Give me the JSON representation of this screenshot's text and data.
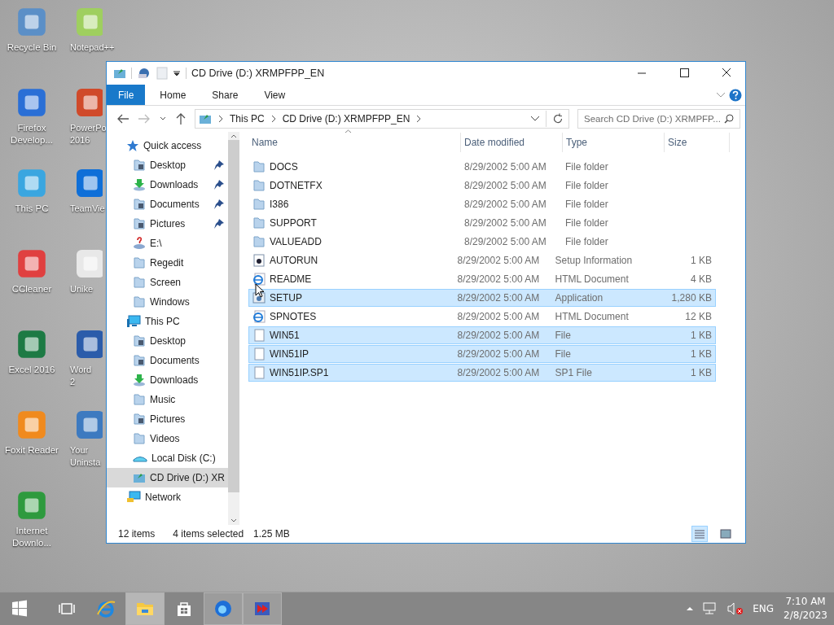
{
  "desktop_icons": [
    {
      "label": "Recycle Bin"
    },
    {
      "label": "Notepad++"
    },
    {
      "label": "Firefox Develop..."
    },
    {
      "label": "PowerPo 2016"
    },
    {
      "label": "This PC"
    },
    {
      "label": "TeamVie"
    },
    {
      "label": "CCleaner"
    },
    {
      "label": "Unike"
    },
    {
      "label": "Excel 2016"
    },
    {
      "label": "Word 2"
    },
    {
      "label": "Foxit Reader"
    },
    {
      "label": "Your Uninsta"
    },
    {
      "label": "Internet Downlo..."
    }
  ],
  "window": {
    "title": "CD Drive (D:) XRMPFPP_EN",
    "ribbon_tabs": [
      {
        "label": "File",
        "selected": true
      },
      {
        "label": "Home",
        "selected": false
      },
      {
        "label": "Share",
        "selected": false
      },
      {
        "label": "View",
        "selected": false
      }
    ],
    "breadcrumb": [
      "This PC",
      "CD Drive (D:) XRMPFPP_EN"
    ],
    "search": {
      "placeholder": "Search CD Drive (D:) XRMPFP..."
    },
    "sidebar": [
      {
        "label": "Quick access",
        "kind": "star",
        "selected": false,
        "children": [
          {
            "label": "Desktop",
            "kind": "desktop",
            "pinned": true,
            "selected": false
          },
          {
            "label": "Downloads",
            "kind": "download",
            "pinned": true,
            "selected": false
          },
          {
            "label": "Documents",
            "kind": "docs",
            "pinned": true,
            "selected": false
          },
          {
            "label": "Pictures",
            "kind": "pictures",
            "pinned": true,
            "selected": false
          },
          {
            "label": "E:\\",
            "kind": "drive",
            "pinned": false,
            "selected": false
          },
          {
            "label": "Regedit",
            "kind": "folder",
            "pinned": false,
            "selected": false
          },
          {
            "label": "Screen",
            "kind": "folder",
            "pinned": false,
            "selected": false
          },
          {
            "label": "Windows",
            "kind": "folder",
            "pinned": false,
            "selected": false
          }
        ]
      },
      {
        "label": "This PC",
        "kind": "pc",
        "selected": false,
        "children": [
          {
            "label": "Desktop",
            "kind": "desktop",
            "pinned": false,
            "selected": false
          },
          {
            "label": "Documents",
            "kind": "docs",
            "pinned": false,
            "selected": false
          },
          {
            "label": "Downloads",
            "kind": "download",
            "pinned": false,
            "selected": false
          },
          {
            "label": "Music",
            "kind": "folder",
            "pinned": false,
            "selected": false
          },
          {
            "label": "Pictures",
            "kind": "pictures",
            "pinned": false,
            "selected": false
          },
          {
            "label": "Videos",
            "kind": "folder",
            "pinned": false,
            "selected": false
          },
          {
            "label": "Local Disk (C:)",
            "kind": "disk",
            "pinned": false,
            "selected": false
          },
          {
            "label": "CD Drive (D:) XR",
            "kind": "cd",
            "pinned": false,
            "selected": true
          }
        ]
      },
      {
        "label": "Network",
        "kind": "network",
        "selected": false
      }
    ],
    "columns": [
      "Name",
      "Date modified",
      "Type",
      "Size"
    ],
    "files": [
      {
        "name": "DOCS",
        "date": "8/29/2002 5:00 AM",
        "type": "File folder",
        "kind": "folder",
        "selected": false
      },
      {
        "name": "DOTNETFX",
        "date": "8/29/2002 5:00 AM",
        "type": "File folder",
        "kind": "folder",
        "selected": false
      },
      {
        "name": "I386",
        "date": "8/29/2002 5:00 AM",
        "type": "File folder",
        "kind": "folder",
        "selected": false
      },
      {
        "name": "SUPPORT",
        "date": "8/29/2002 5:00 AM",
        "type": "File folder",
        "kind": "folder",
        "selected": false
      },
      {
        "name": "VALUEADD",
        "date": "8/29/2002 5:00 AM",
        "type": "File folder",
        "kind": "folder",
        "selected": false
      },
      {
        "name": "AUTORUN",
        "date": "8/29/2002 5:00 AM",
        "type": "Setup Information",
        "size": "1 KB",
        "kind": "setup",
        "selected": false
      },
      {
        "name": "README",
        "date": "8/29/2002 5:00 AM",
        "type": "HTML Document",
        "size": "4 KB",
        "kind": "html",
        "selected": false
      },
      {
        "name": "SETUP",
        "date": "8/29/2002 5:00 AM",
        "type": "Application",
        "size": "1,280 KB",
        "kind": "app",
        "selected": true
      },
      {
        "name": "SPNOTES",
        "date": "8/29/2002 5:00 AM",
        "type": "HTML Document",
        "size": "12 KB",
        "kind": "html",
        "selected": false
      },
      {
        "name": "WIN51",
        "date": "8/29/2002 5:00 AM",
        "type": "File",
        "size": "1 KB",
        "kind": "file",
        "selected": true
      },
      {
        "name": "WIN51IP",
        "date": "8/29/2002 5:00 AM",
        "type": "File",
        "size": "1 KB",
        "kind": "file",
        "selected": true
      },
      {
        "name": "WIN51IP.SP1",
        "date": "8/29/2002 5:00 AM",
        "type": "SP1 File",
        "size": "1 KB",
        "kind": "file",
        "selected": true
      }
    ],
    "status_bar": {
      "count": "12 items",
      "selection": "4 items selected",
      "size": "1.25 MB"
    },
    "views": [
      {
        "kind": "details",
        "selected": true
      },
      {
        "kind": "large",
        "selected": false
      }
    ]
  },
  "taskbar": {
    "apps": [
      {
        "kind": "ie",
        "selected": false
      },
      {
        "kind": "explorer",
        "selected": true
      },
      {
        "kind": "store",
        "selected": false
      },
      {
        "kind": "firefox",
        "selected": false
      },
      {
        "kind": "red",
        "selected": false
      }
    ],
    "language": "ENG",
    "time": "7:10 AM",
    "date": "2/8/2023"
  }
}
